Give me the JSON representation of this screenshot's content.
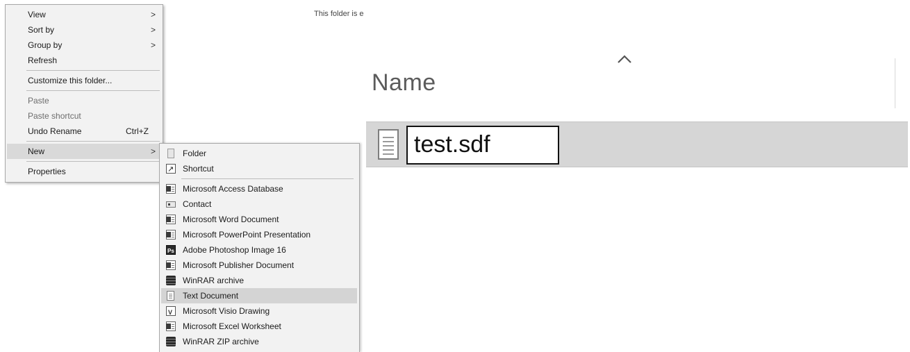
{
  "context_menu": {
    "items": [
      {
        "label": "View",
        "submenu": true
      },
      {
        "label": "Sort by",
        "submenu": true
      },
      {
        "label": "Group by",
        "submenu": true
      },
      {
        "label": "Refresh"
      },
      {
        "label": "Customize this folder..."
      },
      {
        "label": "Paste",
        "disabled": true
      },
      {
        "label": "Paste shortcut",
        "disabled": true
      },
      {
        "label": "Undo Rename",
        "shortcut": "Ctrl+Z"
      },
      {
        "label": "New",
        "submenu": true,
        "selected": true
      },
      {
        "label": "Properties"
      }
    ],
    "arrow_glyph": ">"
  },
  "new_submenu": {
    "items": [
      {
        "label": "Folder",
        "icon": "folder-icon"
      },
      {
        "label": "Shortcut",
        "icon": "shortcut-icon"
      },
      {
        "label": "Microsoft Access Database",
        "icon": "access-icon"
      },
      {
        "label": "Contact",
        "icon": "contact-icon"
      },
      {
        "label": "Microsoft Word Document",
        "icon": "word-icon"
      },
      {
        "label": "Microsoft PowerPoint Presentation",
        "icon": "powerpoint-icon"
      },
      {
        "label": "Adobe Photoshop Image 16",
        "icon": "photoshop-icon"
      },
      {
        "label": "Microsoft Publisher Document",
        "icon": "publisher-icon"
      },
      {
        "label": "WinRAR archive",
        "icon": "winrar-icon"
      },
      {
        "label": "Text Document",
        "icon": "text-document-icon",
        "selected": true
      },
      {
        "label": "Microsoft Visio Drawing",
        "icon": "visio-icon"
      },
      {
        "label": "Microsoft Excel Worksheet",
        "icon": "excel-icon"
      },
      {
        "label": "WinRAR ZIP archive",
        "icon": "winrar-zip-icon"
      }
    ]
  },
  "explorer": {
    "empty_message": "This folder is e",
    "column_header": "Name",
    "sort_icon": "sort-ascending-icon",
    "file": {
      "name": "test.sdf",
      "icon": "text-file-icon",
      "renaming": true
    }
  },
  "colors": {
    "menu_background": "#f2f2f2",
    "menu_highlight": "#d9d9d9",
    "file_row_selected": "#d6d6d6"
  }
}
